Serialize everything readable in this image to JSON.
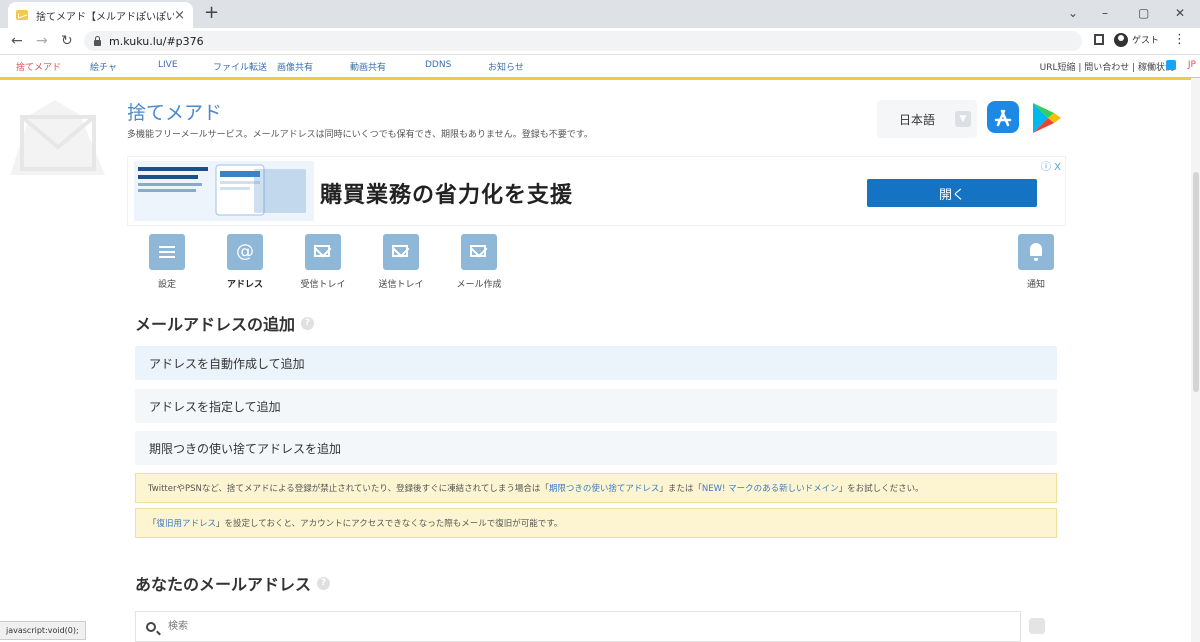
{
  "browser": {
    "tab_title": "捨てメアド【メルアドぽいぽい】",
    "tab_close": "×",
    "new_tab": "+",
    "url": "m.kuku.lu/#p376",
    "guest_label": "ゲスト",
    "controls": {
      "minimize": "–",
      "maximize": "▢",
      "close": "✕",
      "tab_search": "⌄",
      "back": "←",
      "forward": "→",
      "reload": "↻",
      "menu": "⋮"
    },
    "status_text": "javascript:void(0);"
  },
  "site_nav": {
    "items": [
      "捨てメアド",
      "絵チャ",
      "LIVE",
      "ファイル転送",
      "画像共有",
      "動画共有",
      "DDNS",
      "お知らせ"
    ],
    "right_text": "URL短縮 | 問い合わせ | 稼働状況",
    "jp_badge": "JP"
  },
  "header": {
    "title": "捨てメアド",
    "subtitle": "多機能フリーメールサービス。メールアドレスは同時にいくつでも保有でき、期限もありません。登録も不要です。",
    "language": "日本語"
  },
  "ad": {
    "headline": "購買業務の省力化を支援",
    "button": "開く",
    "info": "ⓘ X"
  },
  "menu": {
    "items": [
      {
        "label": "設定",
        "icon": "hamburger-icon"
      },
      {
        "label": "アドレス",
        "icon": "at-icon"
      },
      {
        "label": "受信トレイ",
        "icon": "envelope-icon"
      },
      {
        "label": "送信トレイ",
        "icon": "envelope-icon"
      },
      {
        "label": "メール作成",
        "icon": "envelope-icon"
      }
    ],
    "notify_label": "通知"
  },
  "add_section": {
    "title": "メールアドレスの追加",
    "help": "?",
    "actions": [
      "アドレスを自動作成して追加",
      "アドレスを指定して追加",
      "期限つきの使い捨てアドレスを追加"
    ],
    "notice1": {
      "pre": "TwitterやPSNなど、捨てメアドによる登録が禁止されていたり、登録後すぐに凍結されてしまう場合は「",
      "link1": "期限つきの使い捨てアドレス",
      "mid": "」または「",
      "link2": "NEW! マークのある新しいドメイン",
      "post": "」をお試しください。"
    },
    "notice2": {
      "pre": "「",
      "link": "復旧用アドレス",
      "post": "」を設定しておくと、アカウントにアクセスできなくなった際もメールで復旧が可能です。"
    }
  },
  "address_section": {
    "title": "あなたのメールアドレス",
    "help": "?",
    "search_placeholder": "検索"
  },
  "colors": {
    "accent": "#4a88c7",
    "ad_button": "#1473c3",
    "nav_underline": "#f3c845",
    "notice_bg": "#fdf5d1"
  }
}
